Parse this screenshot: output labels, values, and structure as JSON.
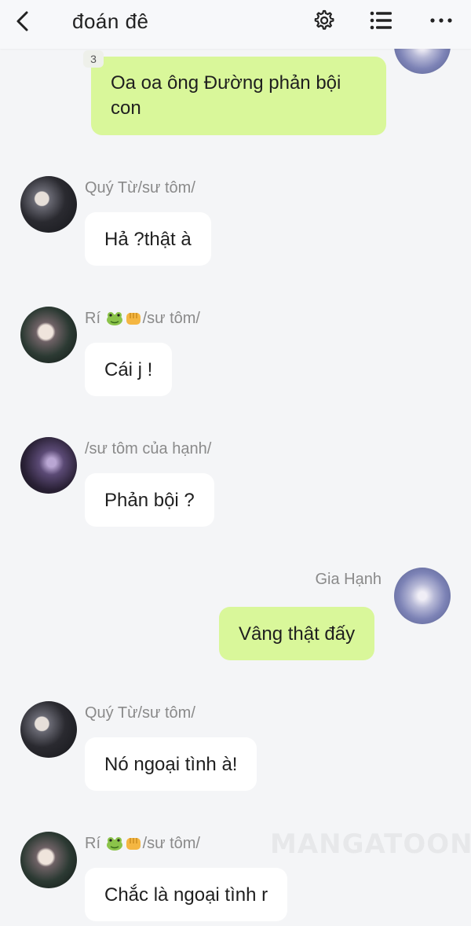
{
  "header": {
    "title": "đoán đê",
    "icons": [
      "back-arrow-icon",
      "settings-gear-icon",
      "list-menu-icon",
      "more-dots-icon"
    ]
  },
  "messages": [
    {
      "side": "right",
      "sender": "",
      "text_lines": [
        "Oa oa ông Đường phản bội",
        "con"
      ],
      "badge": "3"
    },
    {
      "side": "left",
      "sender": "Quý Từ/sư tôm/",
      "text": "Hả ?thật à"
    },
    {
      "side": "left",
      "sender_prefix": "Rí",
      "sender_suffix": "/sư tôm/",
      "text": "Cái j !"
    },
    {
      "side": "left",
      "sender": "/sư tôm của hạnh/",
      "text": "Phản bội ?"
    },
    {
      "side": "right",
      "sender": "Gia Hạnh",
      "text": "Vâng thật đấy"
    },
    {
      "side": "left",
      "sender": "Quý Từ/sư tôm/",
      "text": "Nó ngoại tình à!"
    },
    {
      "side": "left",
      "sender_prefix": "Rí",
      "sender_suffix": "/sư tôm/",
      "text": "Chắc là ngoại tình r"
    }
  ],
  "watermark": "MANGATOON",
  "colors": {
    "outgoing_bubble": "#d9f79a",
    "incoming_bubble": "#ffffff",
    "background": "#f4f5f7"
  }
}
